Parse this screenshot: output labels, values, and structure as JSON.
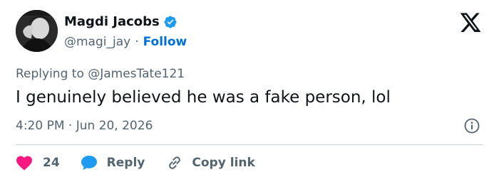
{
  "author": {
    "display_name": "Magdi Jacobs",
    "handle": "@magi_jay",
    "separator": "·",
    "follow_label": "Follow",
    "verified": true
  },
  "tweet": {
    "reply_prefix": "Replying to",
    "reply_mention": "@JamesTate121",
    "text": "I genuinely believed he was a fake person, lol",
    "timestamp": "4:20 PM · Jun 20, 2026"
  },
  "actions": {
    "like_count": "24",
    "reply_label": "Reply",
    "copy_link_label": "Copy link"
  },
  "icons": {
    "verified": "verified-badge-icon",
    "brand": "x-logo-icon",
    "info": "info-icon",
    "like": "heart-icon",
    "reply": "speech-bubble-icon",
    "copy": "link-icon"
  },
  "colors": {
    "accent": "#1d9bf0",
    "follow": "#006fd6",
    "like": "#f91880",
    "text": "#0f1419",
    "muted": "#536471",
    "divider": "#cfd9de"
  }
}
